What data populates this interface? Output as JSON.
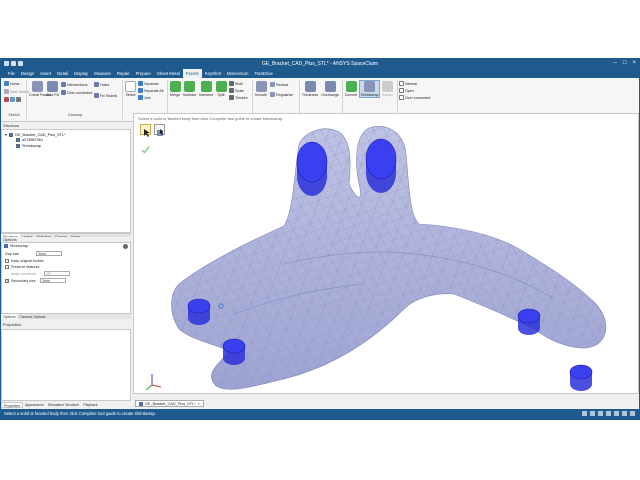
{
  "window": {
    "title": "GE_Bracket_CAD_Plus_STL* - ANSYS SpaceClaim",
    "buttons": [
      "–",
      "□",
      "×"
    ]
  },
  "menu": {
    "tabs": [
      "File",
      "Design",
      "Insert",
      "Detail",
      "Display",
      "Measure",
      "Repair",
      "Prepare",
      "Sheet Metal",
      "Facets",
      "KeyShot",
      "Momentum",
      "TeraDrive"
    ],
    "active": "Facets"
  },
  "ribbon": {
    "sketch": {
      "home": "Home",
      "new_sketch": "New Sketch",
      "group": "Sketch"
    },
    "cleanup": {
      "check_facets": "Check Facets",
      "auto_fix": "Auto Fix",
      "intersections": "Intersections",
      "over_connected": "Over connected",
      "holes": "Holes",
      "fix_shards": "Fix Shards",
      "group": "Cleanup"
    },
    "organize": {
      "select": "Select",
      "separate": "Separate",
      "separate_all": "Separate All",
      "join": "Join",
      "group": "Organize"
    },
    "modify": {
      "merge": "Merge",
      "subtract": "Subtract",
      "intersect": "Intersect",
      "split": "Split",
      "shell": "Shell",
      "scale": "Scale",
      "thicken": "Thicken",
      "group": "Modify"
    },
    "adjust": {
      "smooth": "Smooth",
      "reduce": "Reduce",
      "regularize": "Regularize",
      "group": "Adjust"
    },
    "analyze": {
      "thickness": "Thickness",
      "overhangs": "Overhangs",
      "group": "Analyze"
    },
    "create": {
      "convert": "Convert",
      "shrinkwrap": "Shrinkwrap",
      "export": "Export",
      "group": "Create"
    },
    "edge_display": {
      "internal": "Internal",
      "open": "Open",
      "over_connected": "Over connected",
      "group": "Edge Display"
    }
  },
  "structure": {
    "header": "Structure",
    "tree": [
      "GE_Bracket_CAD_Plus_STL*",
      "a2785570b1",
      "Shrinkwrap"
    ],
    "tabs": [
      "Structure",
      "Layers",
      "Selection",
      "Groups",
      "Views"
    ]
  },
  "options": {
    "header": "Options",
    "section": "Shrinkwrap",
    "gap_size_label": "Gap size",
    "gap_size_value": "3mm",
    "keep_original_bodies": "Keep original bodies",
    "preserve_features": "Preserve features",
    "angle_threshold_label": "Angle threshold",
    "angle_threshold_value": "45°",
    "secondary_size_label": "Secondary size",
    "secondary_size_value": "3mm",
    "tabs": [
      "Options",
      "Camera Options"
    ]
  },
  "properties": {
    "header": "Properties"
  },
  "bottom_tabs": [
    "Properties",
    "Appearance",
    "Simulation Structure",
    "Playback"
  ],
  "viewport": {
    "prompt": "Select a solid or faceted body then click Complete tool guide to create shrinkwrap.",
    "doc_tab": "GE_Bracket_CAD_Plus_STL*",
    "mesh_color": "#a9aed8",
    "hole_color": "#3a3ff0"
  },
  "status": {
    "message": "Select a solid or faceted body then click Complete tool guide to create shrinkwrap."
  }
}
